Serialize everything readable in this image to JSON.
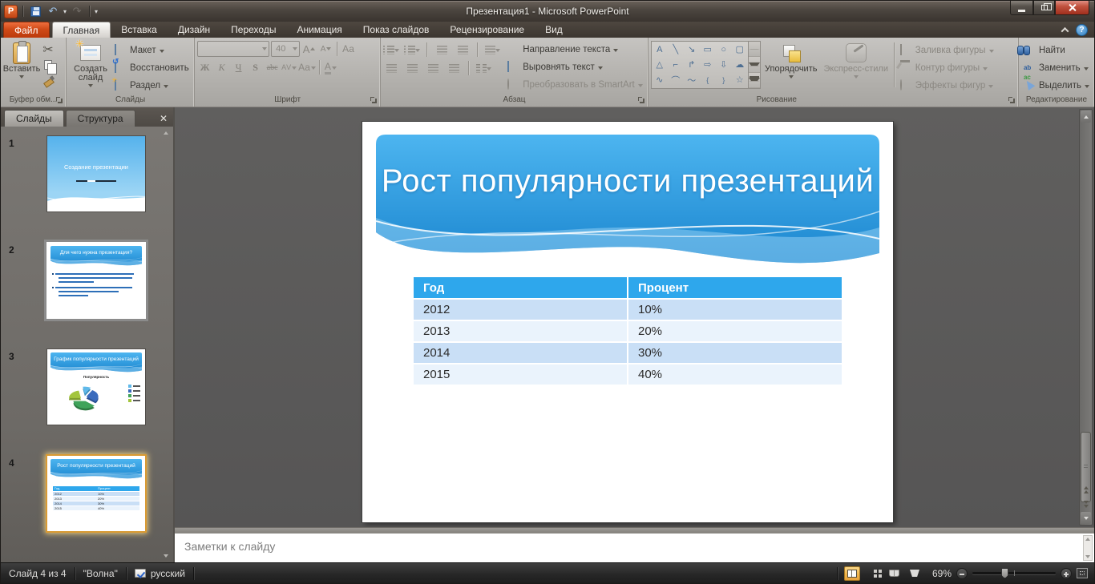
{
  "icons": {
    "app_logo": "P",
    "undo": "↶",
    "redo": "↷",
    "qat_menu_caret": "▾",
    "cut": "✂",
    "help": "?",
    "panel_close": "✕"
  },
  "window": {
    "title": "Презентация1 - Microsoft PowerPoint"
  },
  "tabs": {
    "file": "Файл",
    "items": [
      "Главная",
      "Вставка",
      "Дизайн",
      "Переходы",
      "Анимация",
      "Показ слайдов",
      "Рецензирование",
      "Вид"
    ]
  },
  "ribbon": {
    "clipboard": {
      "group_label": "Буфер обм...",
      "paste_label": "Вставить"
    },
    "slides": {
      "group_label": "Слайды",
      "new_slide_label": "Создать слайд",
      "layout_label": "Макет",
      "reset_label": "Восстановить",
      "section_label": "Раздел"
    },
    "font": {
      "group_label": "Шрифт",
      "size_value": "40",
      "grow_glyph": "А",
      "shrink_glyph": "А",
      "clear_glyph": "Аа",
      "bold_glyph": "Ж",
      "italic_glyph": "К",
      "underline_glyph": "Ч",
      "shadow_glyph": "S",
      "strike_glyph": "abc",
      "spacing_glyph": "АV",
      "case_glyph": "Аа",
      "color_glyph": "А"
    },
    "paragraph": {
      "group_label": "Абзац",
      "text_direction_label": "Направление текста",
      "align_text_label": "Выровнять текст",
      "smartart_label": "Преобразовать в SmartArt"
    },
    "drawing": {
      "group_label": "Рисование",
      "arrange_label": "Упорядочить",
      "quick_styles_label": "Экспресс-стили",
      "shape_glyphs": [
        "A",
        "╲",
        "↘",
        "▭",
        "○",
        "▢",
        "△",
        "⌐",
        "↱",
        "⇨",
        "⇩",
        "☁",
        "∿",
        "⌒",
        "～",
        "{",
        "}",
        "☆"
      ],
      "fill_label": "Заливка фигуры",
      "outline_label": "Контур фигуры",
      "effects_label": "Эффекты фигур"
    },
    "editing": {
      "group_label": "Редактирование",
      "find_label": "Найти",
      "replace_label": "Заменить",
      "select_label": "Выделить"
    }
  },
  "slides_panel": {
    "tab_slides": "Слайды",
    "tab_outline": "Структура",
    "thumbnails": [
      {
        "number": "1",
        "title": "Создание презентации"
      },
      {
        "number": "2",
        "title": "Для чего нужна презентация?"
      },
      {
        "number": "3",
        "title": "График популярности презентаций",
        "chart_label": "Популярность"
      },
      {
        "number": "4",
        "title": "Рост популярности презентаций"
      }
    ]
  },
  "slide": {
    "title": "Рост популярности презентаций",
    "table": {
      "headers": [
        "Год",
        "Процент"
      ],
      "rows": [
        [
          "2012",
          "10%"
        ],
        [
          "2013",
          "20%"
        ],
        [
          "2014",
          "30%"
        ],
        [
          "2015",
          "40%"
        ]
      ]
    }
  },
  "notes": {
    "placeholder": "Заметки к слайду"
  },
  "status_bar": {
    "slide_counter": "Слайд 4 из 4",
    "theme_name": "\"Волна\"",
    "language": "русский",
    "zoom_level": "69%"
  },
  "colors": {
    "accent_blue": "#2ea7ec",
    "header_gradient_top": "#4db5f0",
    "header_gradient_bottom": "#1b86cf",
    "table_row_dark": "#c9dff6",
    "table_row_light": "#eaf3fc",
    "selection_gold": "#e8a33d",
    "file_tab": "#d44a1e"
  }
}
